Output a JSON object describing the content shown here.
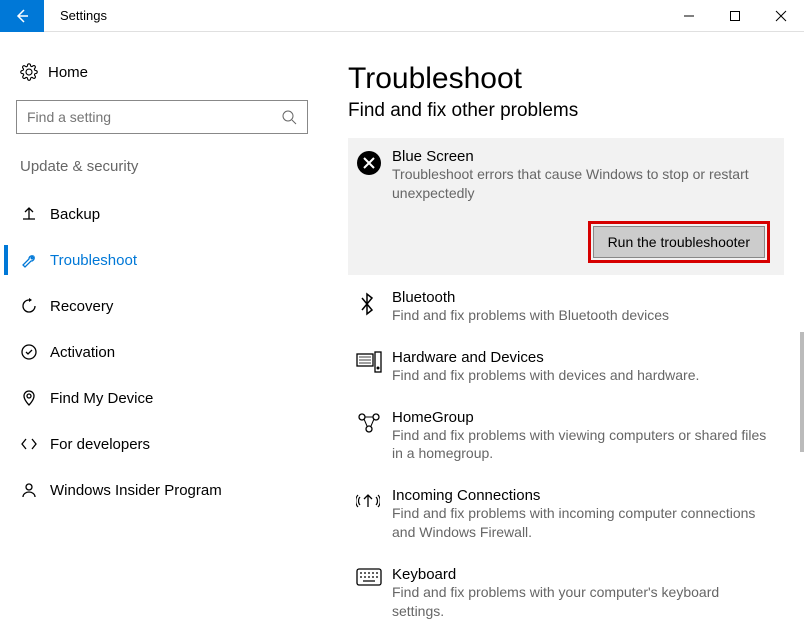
{
  "window": {
    "title": "Settings"
  },
  "sidebar": {
    "home": "Home",
    "search_placeholder": "Find a setting",
    "section": "Update & security",
    "items": [
      {
        "label": "Backup"
      },
      {
        "label": "Troubleshoot"
      },
      {
        "label": "Recovery"
      },
      {
        "label": "Activation"
      },
      {
        "label": "Find My Device"
      },
      {
        "label": "For developers"
      },
      {
        "label": "Windows Insider Program"
      }
    ]
  },
  "main": {
    "title": "Troubleshoot",
    "subtitle": "Find and fix other problems",
    "run_label": "Run the troubleshooter",
    "items": [
      {
        "title": "Blue Screen",
        "desc": "Troubleshoot errors that cause Windows to stop or restart unexpectedly"
      },
      {
        "title": "Bluetooth",
        "desc": "Find and fix problems with Bluetooth devices"
      },
      {
        "title": "Hardware and Devices",
        "desc": "Find and fix problems with devices and hardware."
      },
      {
        "title": "HomeGroup",
        "desc": "Find and fix problems with viewing computers or shared files in a homegroup."
      },
      {
        "title": "Incoming Connections",
        "desc": "Find and fix problems with incoming computer connections and Windows Firewall."
      },
      {
        "title": "Keyboard",
        "desc": "Find and fix problems with your computer's keyboard settings."
      }
    ]
  }
}
